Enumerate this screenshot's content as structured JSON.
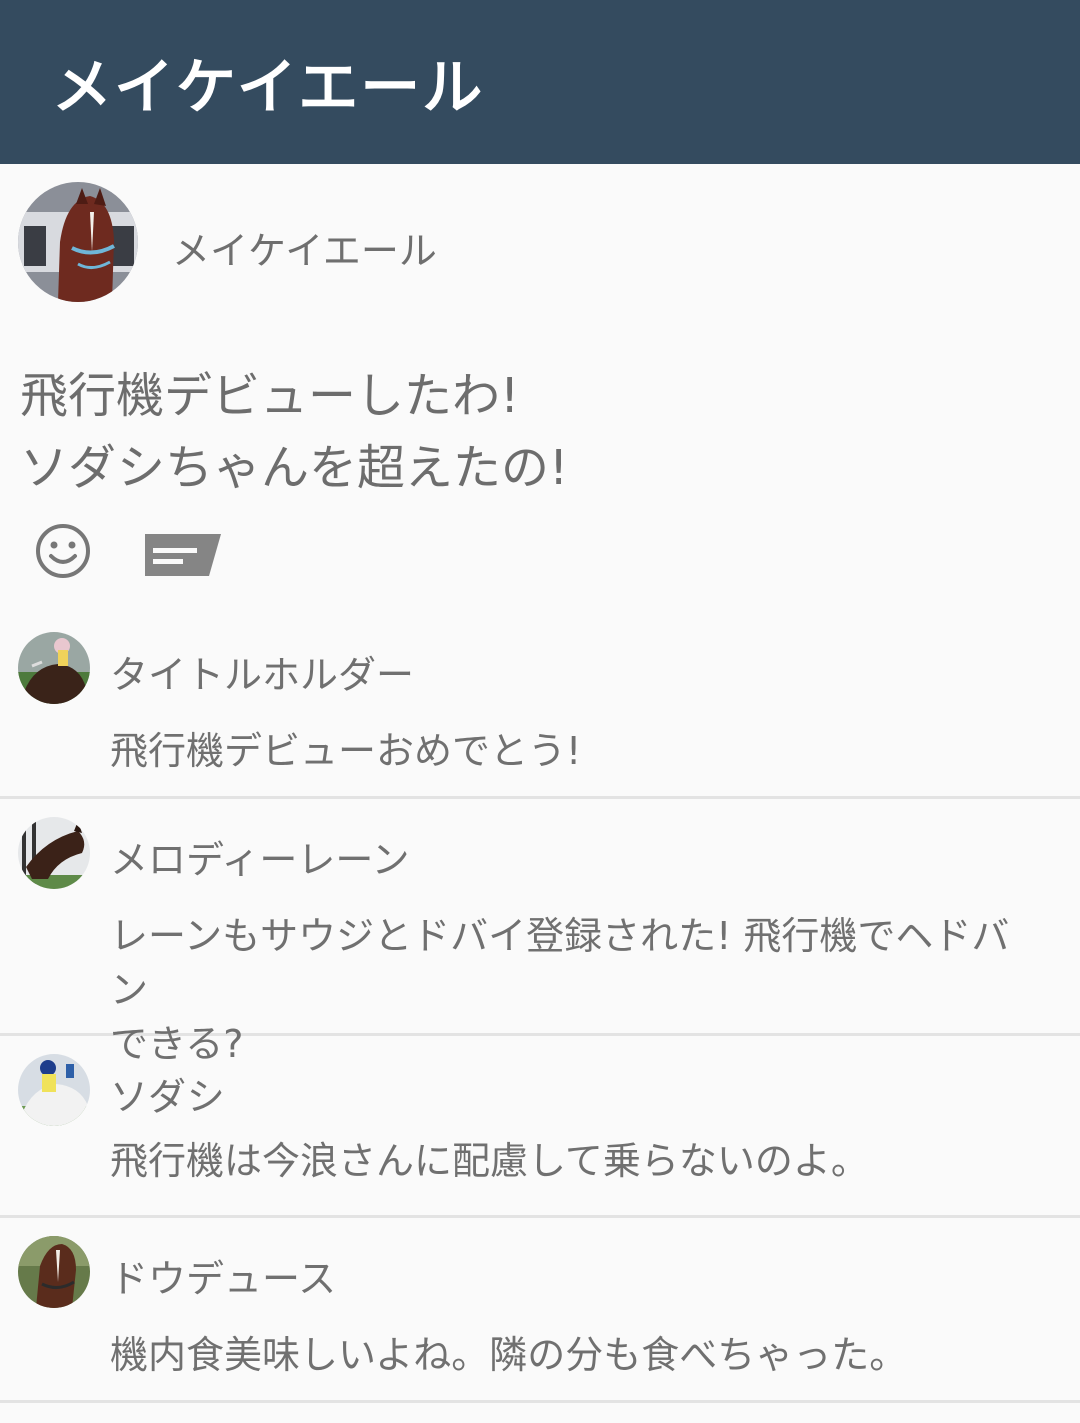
{
  "appbar": {
    "title": "メイケイエール"
  },
  "post": {
    "author": "メイケイエール",
    "lines": [
      "飛行機デビューしたわ!",
      "ソダシちゃんを超えたの!"
    ],
    "actions": {
      "react_icon": "smile-icon",
      "comment_icon": "comment-icon"
    }
  },
  "comments": [
    {
      "name": "タイトルホルダー",
      "text": "飛行機デビューおめでとう!"
    },
    {
      "name": "メロディーレーン",
      "text_lines": [
        "レーンもサウジとドバイ登録された! 飛行機でヘドバン",
        "できる?"
      ]
    },
    {
      "name": "ソダシ",
      "text": "飛行機は今浪さんに配慮して乗らないのよ。"
    },
    {
      "name": "ドウデュース",
      "text": "機内食美味しいよね。隣の分も食べちゃった。"
    }
  ]
}
